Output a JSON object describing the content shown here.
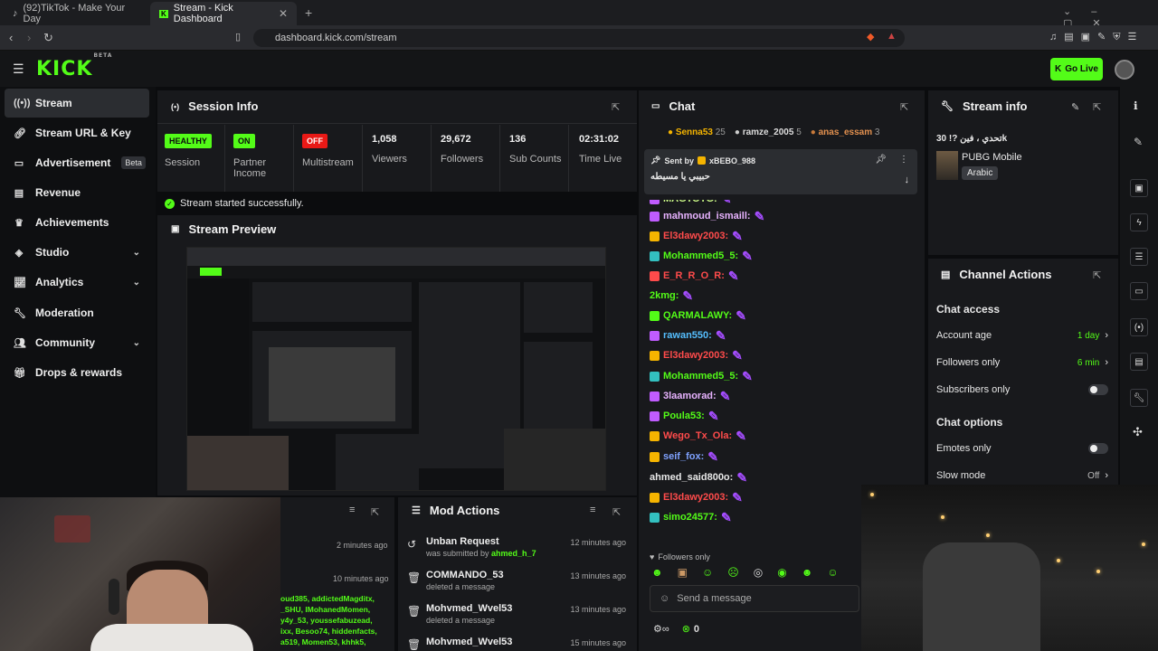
{
  "browser": {
    "tabs": [
      {
        "label": "(92)TikTok - Make Your Day"
      },
      {
        "label": "Stream - Kick Dashboard"
      }
    ],
    "url": "dashboard.kick.com/stream"
  },
  "header": {
    "logo": "KICK",
    "logo_tag": "BETA",
    "go_live": "Go Live",
    "colors": {
      "brand": "#53fc18",
      "offline": "#e91916"
    }
  },
  "sidebar": {
    "items": [
      {
        "label": "Stream",
        "icon": "signal-icon"
      },
      {
        "label": "Stream URL & Key",
        "icon": "link-icon"
      },
      {
        "label": "Advertisement",
        "badge": "Beta",
        "icon": "tv-icon"
      },
      {
        "label": "Revenue",
        "icon": "chart-icon"
      },
      {
        "label": "Achievements",
        "icon": "trophy-icon"
      },
      {
        "label": "Studio",
        "icon": "cube-icon"
      },
      {
        "label": "Analytics",
        "icon": "analytics-icon"
      },
      {
        "label": "Moderation",
        "icon": "wrench-icon"
      },
      {
        "label": "Community",
        "icon": "people-icon"
      },
      {
        "label": "Drops & rewards",
        "icon": "gift-icon"
      }
    ]
  },
  "session": {
    "title": "Session Info",
    "stats": [
      {
        "value": "HEALTHY",
        "label": "Session",
        "type": "pill-green"
      },
      {
        "value": "ON",
        "label": "Partner Income",
        "type": "pill-green"
      },
      {
        "value": "OFF",
        "label": "Multistream",
        "type": "pill-red"
      },
      {
        "value": "1,058",
        "label": "Viewers"
      },
      {
        "value": "29,672",
        "label": "Followers"
      },
      {
        "value": "136",
        "label": "Sub Counts"
      },
      {
        "value": "02:31:02",
        "label": "Time Live"
      }
    ],
    "success": "Stream started successfully."
  },
  "preview": {
    "title": "Stream Preview"
  },
  "chat": {
    "title": "Chat",
    "top": [
      {
        "name": "Senna53",
        "count": "25"
      },
      {
        "name": "ramze_2005",
        "count": "5"
      },
      {
        "name": "anas_essam",
        "count": "3"
      }
    ],
    "pinned": {
      "sent_by_label": "Sent by",
      "user": "xBEBO_988",
      "text": "حبيبي يا مسيطه"
    },
    "messages": [
      {
        "user": "MAGTOTG:",
        "color": "#d0ff8a"
      },
      {
        "user": "mahmoud_ismaill:",
        "color": "#e8b3ff"
      },
      {
        "user": "El3dawy2003:",
        "color": "#ff4b4b"
      },
      {
        "user": "Mohammed5_5:",
        "color": "#53fc18"
      },
      {
        "user": "E_R_R_O_R:",
        "color": "#ff4b4b"
      },
      {
        "user": "2kmg:",
        "color": "#53fc18"
      },
      {
        "user": "QARMALAWY:",
        "color": "#53fc18"
      },
      {
        "user": "rawan550:",
        "color": "#55bfff"
      },
      {
        "user": "El3dawy2003:",
        "color": "#ff4b4b"
      },
      {
        "user": "Mohammed5_5:",
        "color": "#53fc18"
      },
      {
        "user": "3laamorad:",
        "color": "#e8b3ff"
      },
      {
        "user": "Poula53:",
        "color": "#53fc18"
      },
      {
        "user": "Wego_Tx_Ola:",
        "color": "#ff4b4b"
      },
      {
        "user": "seif_fox:",
        "color": "#7fa2ff"
      },
      {
        "user": "ahmed_said800o:",
        "color": "#e8e8e8"
      },
      {
        "user": "El3dawy2003:",
        "color": "#ff4b4b"
      },
      {
        "user": "simo24577:",
        "color": "#53fc18"
      }
    ],
    "followers_only": "Followers only",
    "send_placeholder": "Send a message",
    "viewer_count": "0"
  },
  "stream_info": {
    "title": "Stream info",
    "stream_title": "تحدي ، فين ?! 30k",
    "category": "PUBG Mobile",
    "language": "Arabic"
  },
  "channel_actions": {
    "title": "Channel Actions",
    "chat_access": "Chat access",
    "rows": [
      {
        "label": "Account age",
        "value": "1 day"
      },
      {
        "label": "Followers only",
        "value": "6 min"
      },
      {
        "label": "Subscribers only",
        "value": ""
      }
    ],
    "chat_options": "Chat options",
    "options": [
      {
        "label": "Emotes only",
        "value": ""
      },
      {
        "label": "Slow mode",
        "value": "Off"
      }
    ]
  },
  "mod_actions": {
    "title": "Mod Actions",
    "items": [
      {
        "title": "Unban Request",
        "sub": "was submitted by",
        "who": "ahmed_h_7",
        "time": "12 minutes ago"
      },
      {
        "title": "COMMANDO_53",
        "sub": "deleted a message",
        "who": "",
        "time": "13 minutes ago"
      },
      {
        "title": "Mohvmed_Wvel53",
        "sub": "deleted a message",
        "who": "",
        "time": "13 minutes ago"
      },
      {
        "title": "Mohvmed_Wvel53",
        "sub": "",
        "who": "",
        "time": "15 minutes ago"
      }
    ]
  },
  "activity": {
    "times": [
      "2 minutes ago",
      "10 minutes ago"
    ],
    "names": [
      "oud385, addictedMagditx,",
      "_SHU, IMohanedMomen,",
      "y4y_53, youssefabuzead,",
      "ixx, Besoo74, hiddenfacts,",
      "a519, Momen53, khhk5,"
    ]
  }
}
